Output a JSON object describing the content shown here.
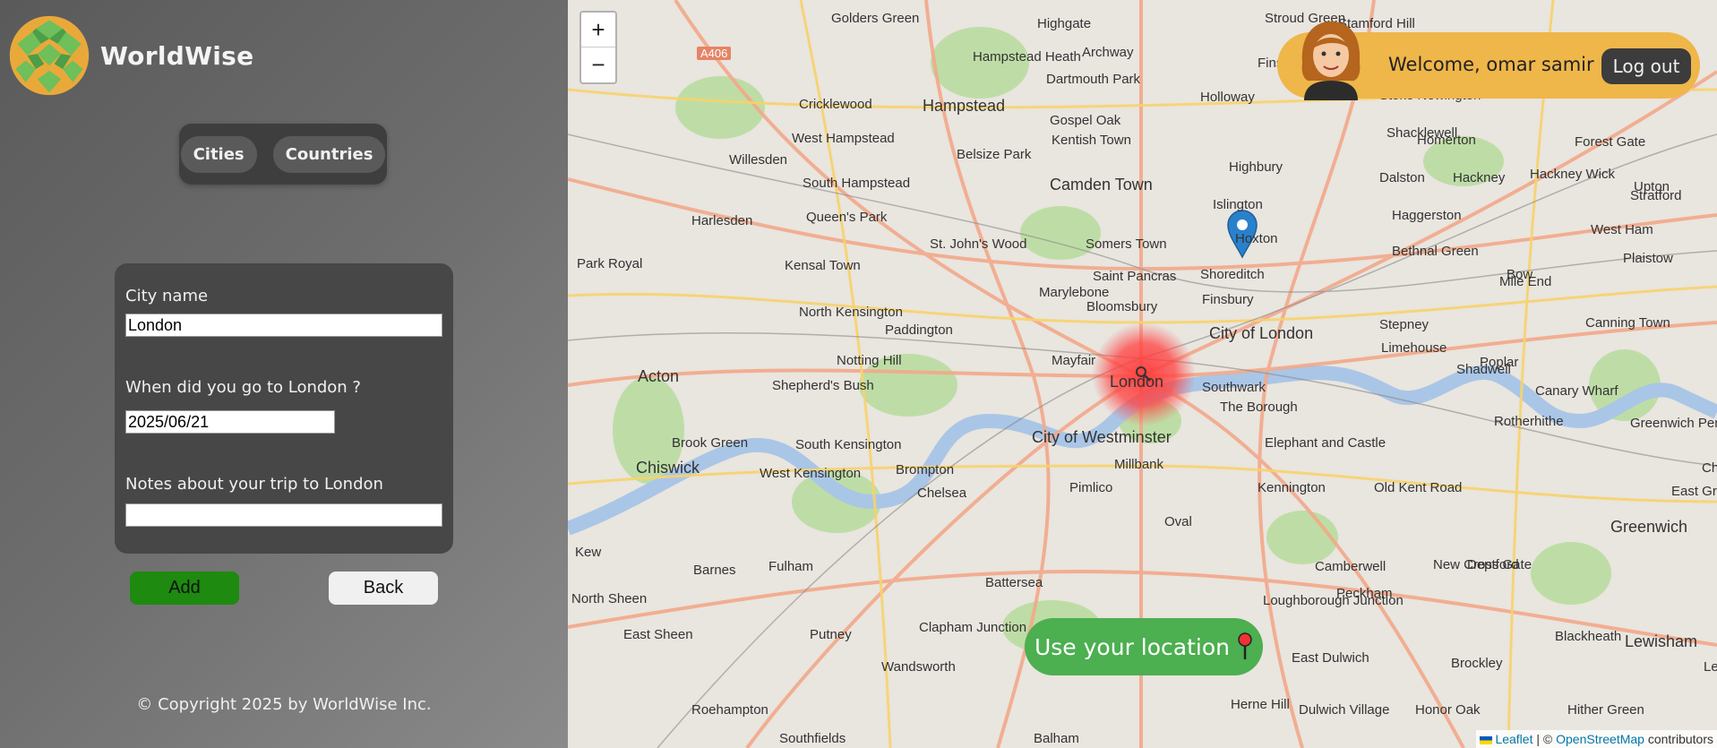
{
  "app": {
    "name": "WorldWise"
  },
  "nav": {
    "cities": "Cities",
    "countries": "Countries"
  },
  "form": {
    "city_label": "City name",
    "city_value": "London",
    "date_label": "When did you go to London ?",
    "date_value": "2025/06/21",
    "notes_label": "Notes about your trip to London",
    "notes_value": ""
  },
  "buttons": {
    "add": "Add",
    "back": "Back"
  },
  "footer": {
    "copyright": "© Copyright 2025 by WorldWise Inc."
  },
  "map": {
    "zoom_in": "+",
    "zoom_out": "−",
    "use_location": "Use your location",
    "attribution": {
      "leaflet": "Leaflet",
      "separator": "| ©",
      "osm": "OpenStreetMap",
      "suffix": "contributors"
    },
    "road_label": "A406",
    "labels": [
      "Golders Green",
      "Highgate",
      "Stroud Green",
      "Stamford Hill",
      "Archway",
      "Hampstead Heath",
      "Finsbury Park",
      "Dartmouth Park",
      "Cricklewood",
      "Hampstead",
      "Gospel Oak",
      "Holloway",
      "Stoke Newington",
      "West Hampstead",
      "Kentish Town",
      "Shacklewell",
      "Homerton",
      "Forest Gate",
      "Willesden",
      "Belsize Park",
      "Highbury",
      "Dalston",
      "Hackney",
      "Hackney Wick",
      "Stratford",
      "South Hampstead",
      "Camden Town",
      "Upton",
      "Harlesden",
      "Queen's Park",
      "Islington",
      "Haggerston",
      "West Ham",
      "St. John's Wood",
      "Somers Town",
      "Hoxton",
      "Bethnal Green",
      "Bow",
      "Plaistow",
      "Park Royal",
      "Kensal Town",
      "Saint Pancras",
      "Shoreditch",
      "Mile End",
      "Marylebone",
      "Bloomsbury",
      "Finsbury",
      "North Kensington",
      "Paddington",
      "City of London",
      "Stepney",
      "Canning Town",
      "Notting Hill",
      "Mayfair",
      "Limehouse",
      "Acton",
      "Shepherd's Bush",
      "Southwark",
      "Shadwell",
      "Poplar",
      "Canary Wharf",
      "The Borough",
      "Rotherhithe",
      "Greenwich Peninsula",
      "London",
      "City of Westminster",
      "Brook Green",
      "South Kensington",
      "Elephant and Castle",
      "Chiswick",
      "West Kensington",
      "Brompton",
      "Millbank",
      "Kennington",
      "Old Kent Road",
      "Charlton",
      "Chelsea",
      "Pimlico",
      "East Greenwich",
      "Oval",
      "Greenwich",
      "Kew",
      "Fulham",
      "Battersea",
      "Camberwell",
      "Peckham",
      "New Cross Gate",
      "Deptford",
      "Barnes",
      "North Sheen",
      "Loughborough Junction",
      "East Sheen",
      "Putney",
      "Clapham Junction",
      "East Dulwich",
      "Brockley",
      "Blackheath",
      "Wandsworth",
      "Lewisham",
      "Herne Hill",
      "Lee",
      "Roehampton",
      "Dulwich Village",
      "Honor Oak",
      "Hither Green",
      "Southfields",
      "Balham"
    ]
  },
  "user": {
    "welcome": "Welcome, omar samir",
    "logout": "Log out"
  },
  "colors": {
    "accent_green": "#4caf50",
    "add_green": "#1e8a0f",
    "user_bar": "#efb649",
    "sidebar": "#5a5a5a"
  }
}
